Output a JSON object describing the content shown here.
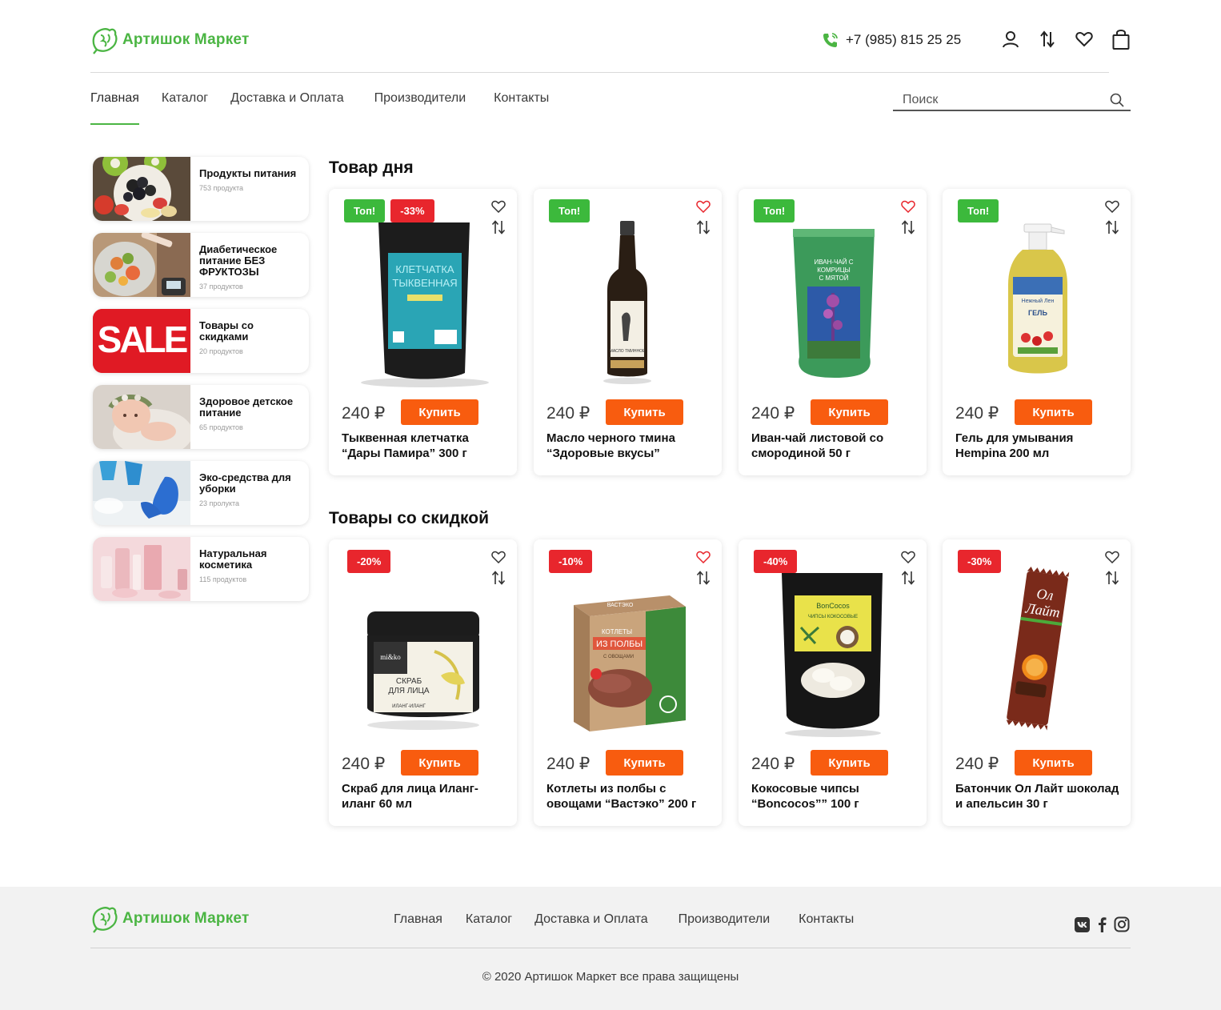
{
  "brand": {
    "name": "Артишок Маркет",
    "color": "#4bb543"
  },
  "header": {
    "phone": "+7 (985) 815 25 25",
    "icons": [
      "phone-icon",
      "user-icon",
      "compare-icon",
      "heart-icon",
      "cart-icon"
    ]
  },
  "nav": {
    "items": [
      "Главная",
      "Каталог",
      "Доставка и Оплата",
      "Производители",
      "Контакты"
    ],
    "active": "Главная"
  },
  "search": {
    "placeholder": "Поиск",
    "value": ""
  },
  "categories": [
    {
      "title": "Продукты питания",
      "count": "753 продукта"
    },
    {
      "title": "Диабетическое питание БЕЗ ФРУКТОЗЫ",
      "count": "37 продуктов"
    },
    {
      "title": "Товары со скидками",
      "count": "20 продуктов"
    },
    {
      "title": "Здоровое детское питание",
      "count": "65 продуктов"
    },
    {
      "title": "Эко-средства для уборки",
      "count": "23 пролукта"
    },
    {
      "title": "Натуральная косметика",
      "count": "115 продуктов"
    }
  ],
  "sale_banner_text": "SALE",
  "sections": {
    "day": {
      "title": "Товар дня",
      "products": [
        {
          "badges": [
            "Топ!",
            "-33%"
          ],
          "price": "240 ₽",
          "buy": "Купить",
          "name": "Тыквенная клетчатка “Дары Памира” 300 г",
          "favorite": false
        },
        {
          "badges": [
            "Топ!"
          ],
          "price": "240 ₽",
          "buy": "Купить",
          "name": "Масло черного тмина “Здоровые вкусы”",
          "favorite": true
        },
        {
          "badges": [
            "Топ!"
          ],
          "price": "240 ₽",
          "buy": "Купить",
          "name": "Иван-чай листовой со смородиной 50 г",
          "favorite": true
        },
        {
          "badges": [
            "Топ!"
          ],
          "price": "240 ₽",
          "buy": "Купить",
          "name": "Гель для умывания Hempina 200 мл",
          "favorite": false
        }
      ]
    },
    "discount": {
      "title": "Товары со скидкой",
      "products": [
        {
          "badges": [
            "-20%"
          ],
          "price": "240 ₽",
          "buy": "Купить",
          "name": "Скраб для лица Иланг-иланг 60 мл",
          "favorite": false
        },
        {
          "badges": [
            "-10%"
          ],
          "price": "240 ₽",
          "buy": "Купить",
          "name": "Котлеты из полбы с овощами “Вастэко” 200 г",
          "favorite": true
        },
        {
          "badges": [
            "-40%"
          ],
          "price": "240 ₽",
          "buy": "Купить",
          "name": "Кокосовые чипсы “Boncocos”” 100 г",
          "favorite": false
        },
        {
          "badges": [
            "-30%"
          ],
          "price": "240 ₽",
          "buy": "Купить",
          "name": "Батончик Ол Лайт шоколад и апельсин 30 г",
          "favorite": false
        }
      ]
    }
  },
  "packaging_text": {
    "fiber": [
      "КЛЕТЧАТКА",
      "ТЫКВЕННАЯ"
    ],
    "oil": "МАСЛО ТМИННОЕ",
    "tea": [
      "ИВАН-ЧАЙ С",
      "КОМРИЦЫ",
      "С МЯТОЙ"
    ],
    "gel": [
      "Нежный Лен",
      "ГЕЛЬ"
    ],
    "scrub": [
      "mi&ko",
      "СКРАБ",
      "ДЛЯ ЛИЦА",
      "ИЛАНГ-ИЛАНГ"
    ],
    "cutlets": [
      "ВАСТЭКО",
      "КОТЛЕТЫ",
      "ИЗ ПОЛБЫ",
      "С ОВОЩАМИ"
    ],
    "coco": [
      "BonCocos",
      "ЧИПСЫ КОКОСОВЫЕ"
    ],
    "bar": [
      "Ол",
      "Лайт"
    ]
  },
  "colors": {
    "accent": "#4bb543",
    "buy": "#f85c0f",
    "top_badge": "#3cb93c",
    "sale_badge": "#e8262d",
    "heart_active": "#e8262d"
  },
  "footer": {
    "nav": [
      "Главная",
      "Каталог",
      "Доставка и Оплата",
      "Производители",
      "Контакты"
    ],
    "social": [
      "vk-icon",
      "facebook-icon",
      "instagram-icon"
    ],
    "copyright": "© 2020 Артишок Маркет все права защищены"
  }
}
